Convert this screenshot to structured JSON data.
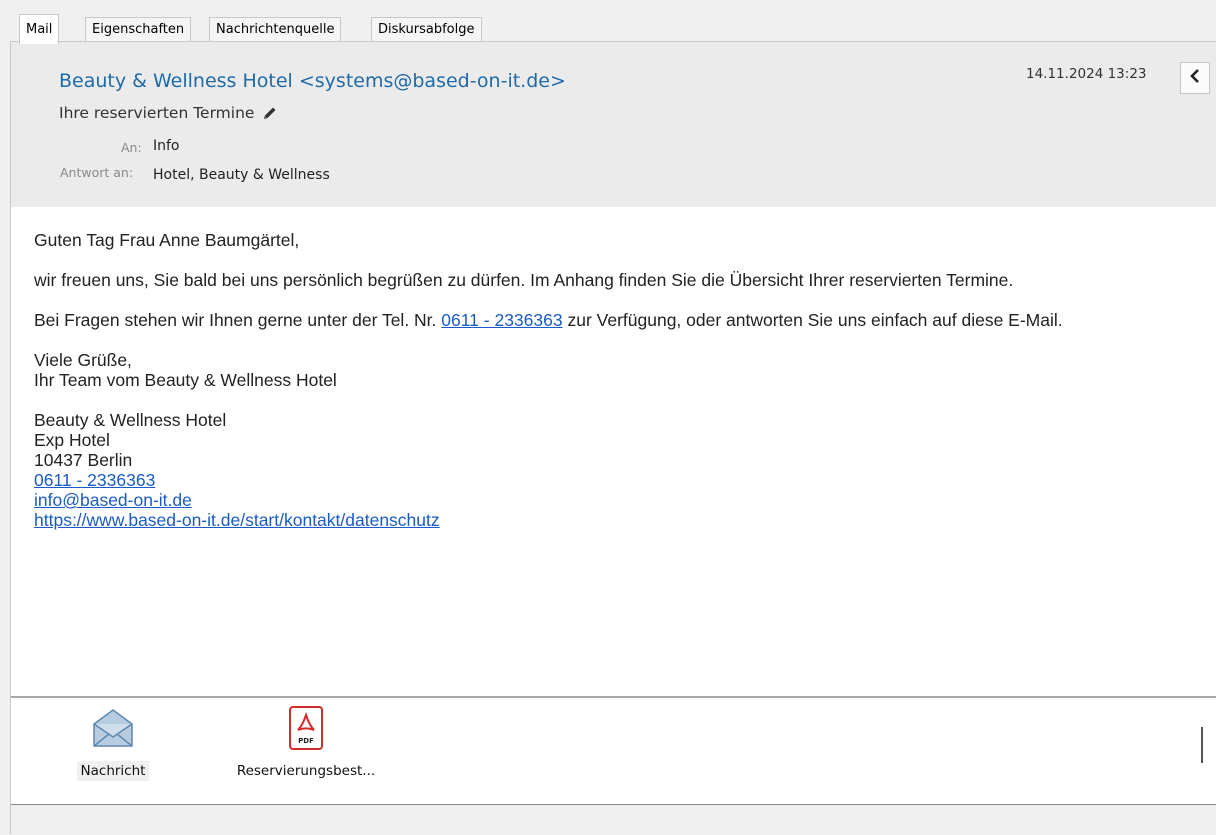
{
  "tabs": [
    "Mail",
    "Eigenschaften",
    "Nachrichtenquelle",
    "Diskursabfolge"
  ],
  "header": {
    "from": "Beauty & Wellness Hotel <systems@based-on-it.de>",
    "subject": "Ihre reservierten Termine",
    "to_label": "An:",
    "to_value": "Info",
    "reply_label": "Antwort an:",
    "reply_value": "Hotel, Beauty & Wellness",
    "date": "14.11.2024 13:23"
  },
  "body": {
    "greeting": "Guten Tag Frau Anne Baumgärtel,",
    "para1": "wir freuen uns, Sie bald bei uns persönlich begrüßen zu dürfen. Im Anhang finden Sie die Übersicht Ihrer reservierten Termine.",
    "para2_before": "Bei Fragen stehen wir Ihnen gerne unter der Tel. Nr. ",
    "para2_phone": "0611 - 2336363",
    "para2_after": " zur Verfügung, oder antworten Sie uns einfach auf diese E-Mail.",
    "closing1": "Viele Grüße,",
    "closing2": "Ihr Team vom Beauty & Wellness Hotel",
    "sig_name": "Beauty & Wellness Hotel",
    "sig_line2": "Exp Hotel",
    "sig_city": "10437 Berlin",
    "sig_phone": "0611 - 2336363",
    "sig_email": "info@based-on-it.de",
    "sig_url": "https://www.based-on-it.de/start/kontakt/datenschutz"
  },
  "attachments": [
    {
      "label": "Nachricht",
      "icon": "envelope-icon"
    },
    {
      "label": "Reservierungsbest...",
      "icon": "pdf-icon"
    }
  ],
  "colors": {
    "link": "#1a5bc4",
    "from": "#1f6aa8",
    "pdf": "#d6292b"
  }
}
